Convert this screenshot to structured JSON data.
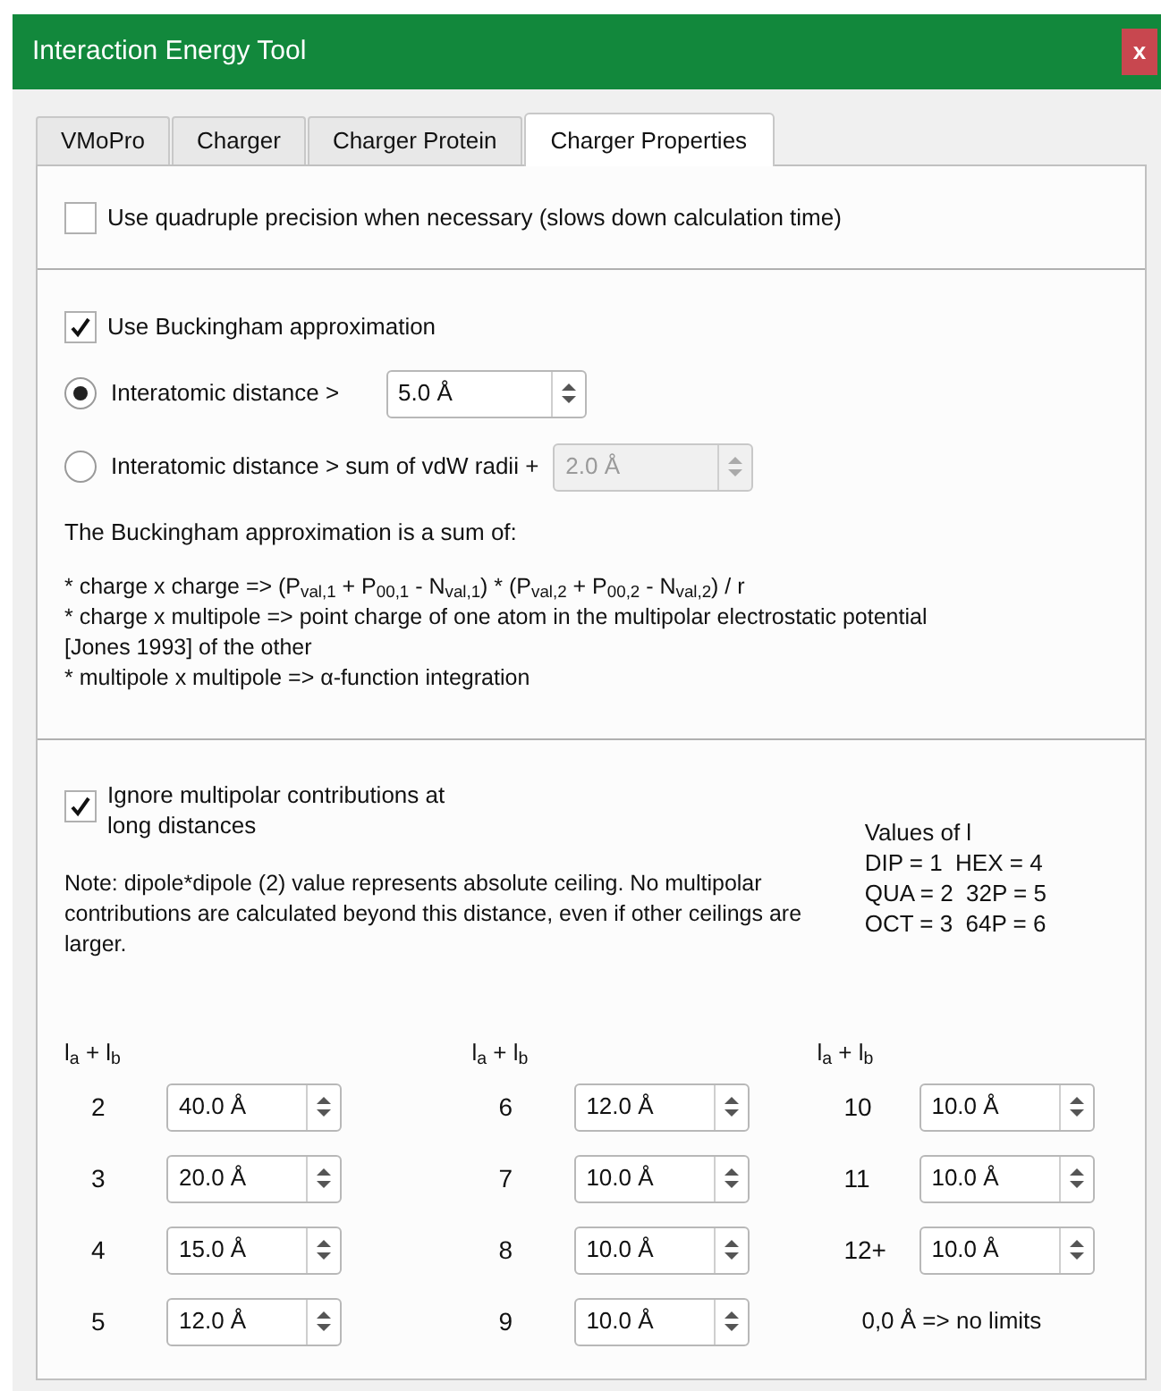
{
  "window": {
    "title": "Interaction Energy Tool",
    "close": "x"
  },
  "tabs": [
    {
      "label": "VMoPro",
      "selected": false
    },
    {
      "label": "Charger",
      "selected": false
    },
    {
      "label": "Charger Protein",
      "selected": false
    },
    {
      "label": "Charger Properties",
      "selected": true
    }
  ],
  "quad_precision": {
    "label": "Use quadruple precision when necessary (slows down calculation time)",
    "checked": false
  },
  "buckingham": {
    "label": "Use Buckingham approximation",
    "checked": true
  },
  "distance_options": [
    {
      "label": "Interatomic distance >",
      "selected": true,
      "value": "5.0 Å",
      "disabled": false
    },
    {
      "label": "Interatomic distance > sum of vdW radii +",
      "selected": false,
      "value": "2.0 Å",
      "disabled": true
    }
  ],
  "description": {
    "intro": "The Buckingham approximation is a sum of:",
    "lines": [
      "* charge x charge => (P$_{val,1}$ + P$_{00,1}$ - N$_{val,1}$) * (P$_{val,2}$ + P$_{00,2}$ - N$_{val,2}$) / r",
      "* charge x multipole => point charge of one atom in the multipolar electrostatic potential [Jones 1993] of the other",
      "* multipole x multipole => α-function integration"
    ]
  },
  "ignore_multipolar": {
    "label": "Ignore multipolar contributions at long distances",
    "checked": true
  },
  "note": "Note: dipole*dipole (2) value represents absolute ceiling. No multipolar contributions are calculated beyond this distance, even if other ceilings are larger.",
  "values_of_l": {
    "title": "Values of l",
    "lines": [
      "DIP = 1  HEX = 4",
      "QUA = 2  32P = 5",
      "OCT = 3  64P = 6"
    ]
  },
  "ceilings": [
    {
      "header": "l$_{a}$ + l$_{b}$",
      "rows": [
        {
          "label": "2",
          "value": "40.0 Å"
        },
        {
          "label": "3",
          "value": "20.0 Å"
        },
        {
          "label": "4",
          "value": "15.0 Å"
        },
        {
          "label": "5",
          "value": "12.0 Å"
        }
      ]
    },
    {
      "header": "l$_{a}$ + l$_{b}$",
      "rows": [
        {
          "label": "6",
          "value": "12.0 Å"
        },
        {
          "label": "7",
          "value": "10.0 Å"
        },
        {
          "label": "8",
          "value": "10.0 Å"
        },
        {
          "label": "9",
          "value": "10.0 Å"
        }
      ]
    },
    {
      "header": "l$_{a}$ + l$_{b}$",
      "rows": [
        {
          "label": "10",
          "value": "10.0 Å"
        },
        {
          "label": "11",
          "value": "10.0 Å"
        },
        {
          "label": "12+",
          "value": "10.0 Å"
        }
      ],
      "footer": "0,0 Å => no limits"
    }
  ]
}
